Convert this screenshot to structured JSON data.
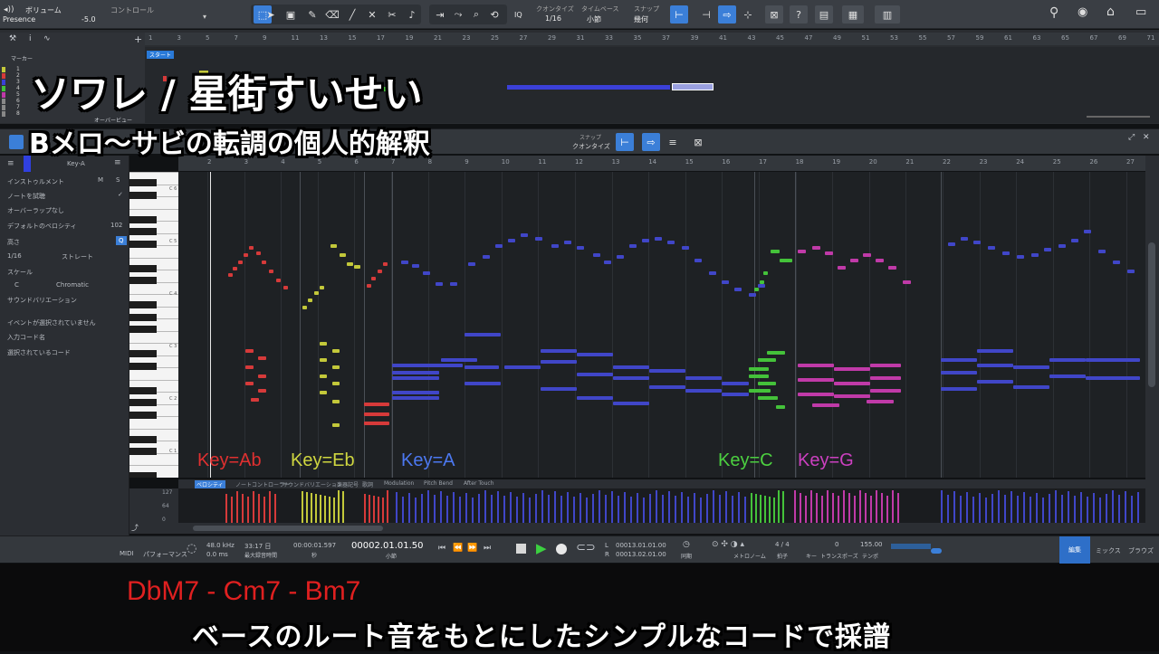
{
  "toolbar": {
    "volume_label": "ボリューム",
    "control_label": "コントロール",
    "preset_name": "Presence",
    "volume_value": "-5.0",
    "quantize_label": "クオンタイズ",
    "quantize_value": "1/16",
    "timebase_label": "タイムベース",
    "timebase_value": "小節",
    "snap_label": "スナップ",
    "snap_value": "幾何",
    "iq_label": "IQ"
  },
  "arrange": {
    "marker_label": "マーカー",
    "start_marker": "スタート",
    "overview_label": "オーバービュー",
    "track_numbers": [
      "1",
      "2",
      "3",
      "4",
      "5",
      "6",
      "7",
      "8"
    ],
    "ruler_numbers": [
      "1",
      "3",
      "5",
      "7",
      "9",
      "11",
      "13",
      "15",
      "17",
      "19",
      "21",
      "23",
      "25",
      "27",
      "29",
      "31",
      "33",
      "35",
      "37",
      "39",
      "41",
      "43",
      "45",
      "47",
      "49",
      "51",
      "53",
      "55",
      "57",
      "59",
      "61",
      "63",
      "65",
      "67",
      "69",
      "71"
    ]
  },
  "editor": {
    "track_name": "Key-A",
    "snap_label": "スナップ",
    "quantize_label": "クオンタイズ",
    "ruler_numbers": [
      "2",
      "3",
      "4",
      "5",
      "6",
      "7",
      "8",
      "9",
      "10",
      "11",
      "12",
      "13",
      "14",
      "15",
      "16",
      "17",
      "18",
      "19",
      "20",
      "21",
      "22",
      "23",
      "24",
      "25",
      "26",
      "27"
    ]
  },
  "inspector": {
    "instrument": "インストゥルメント",
    "m": "M",
    "s": "S",
    "audition": "ノートを試聴",
    "overlap": "オーバーラップなし",
    "default_velocity_label": "デフォルトのベロシティ",
    "default_velocity_value": "102",
    "pitch_label": "高さ",
    "q": "Q",
    "grid_value": "1/16",
    "grid_mode": "ストレート",
    "scale_label": "スケール",
    "scale_root": "C",
    "scale_type": "Chromatic",
    "sound_variation": "サウンドバリエーション",
    "no_event": "イベントが選択されていません",
    "input_chord": "入力コード名",
    "selected_chord": "選択されているコード"
  },
  "piano_labels": [
    "C 6",
    "C 5",
    "C 4",
    "C 3",
    "C 2",
    "C 1"
  ],
  "velocity_tabs": [
    "ベロシティ",
    "ノートコントローラー",
    "サウンドバリエーション",
    "楽器記号",
    "歌詞",
    "Modulation",
    "Pitch Bend",
    "After Touch"
  ],
  "velocity_scale": [
    "127",
    "64",
    "0"
  ],
  "transport": {
    "midi": "MIDI",
    "performance": "パフォーマンス",
    "sample_rate": "48.0 kHz",
    "latency": "0.0 ms",
    "duration": "33:17 日",
    "duration_label": "最大録音時間",
    "time_sec": "00:00:01.597",
    "time_sec_label": "秒",
    "bars": "00002.01.01.50",
    "bars_label": "小節",
    "loop_l": "00013.01.01.00",
    "loop_r": "00013.02.01.00",
    "l": "L",
    "r": "R",
    "sync": "同期",
    "metronome": "メトロノーム",
    "time_sig": "4 / 4",
    "time_sig_label": "拍子",
    "key_label": "キー",
    "transpose": "0",
    "transpose_label": "トランスポーズ",
    "tempo": "155.00",
    "tempo_label": "テンポ",
    "edit_tab": "編集",
    "mix_tab": "ミックス",
    "browse_tab": "ブラウズ"
  },
  "overlay": {
    "title": "ソワレ / 星街すいせい",
    "subtitle": "Bメロ～サビの転調の個人的解釈",
    "chords": "DbM7 - Cm7 - Bm7",
    "caption": "ベースのルート音をもとにしたシンプルなコードで採譜"
  },
  "key_labels": [
    {
      "text": "Key=Ab",
      "color": "#e03030"
    },
    {
      "text": "Key=Eb",
      "color": "#cfd640"
    },
    {
      "text": "Key=A",
      "color": "#4c78f0"
    },
    {
      "text": "Key=C",
      "color": "#4cd040"
    },
    {
      "text": "Key=G",
      "color": "#cc40c0"
    }
  ],
  "colors": {
    "ab": "#d63a3a",
    "eb": "#c3c83a",
    "a": "#4046c8",
    "c": "#44c23a",
    "g": "#c03aa8",
    "accent": "#3b7fd8",
    "chord_text": "#e02020"
  }
}
